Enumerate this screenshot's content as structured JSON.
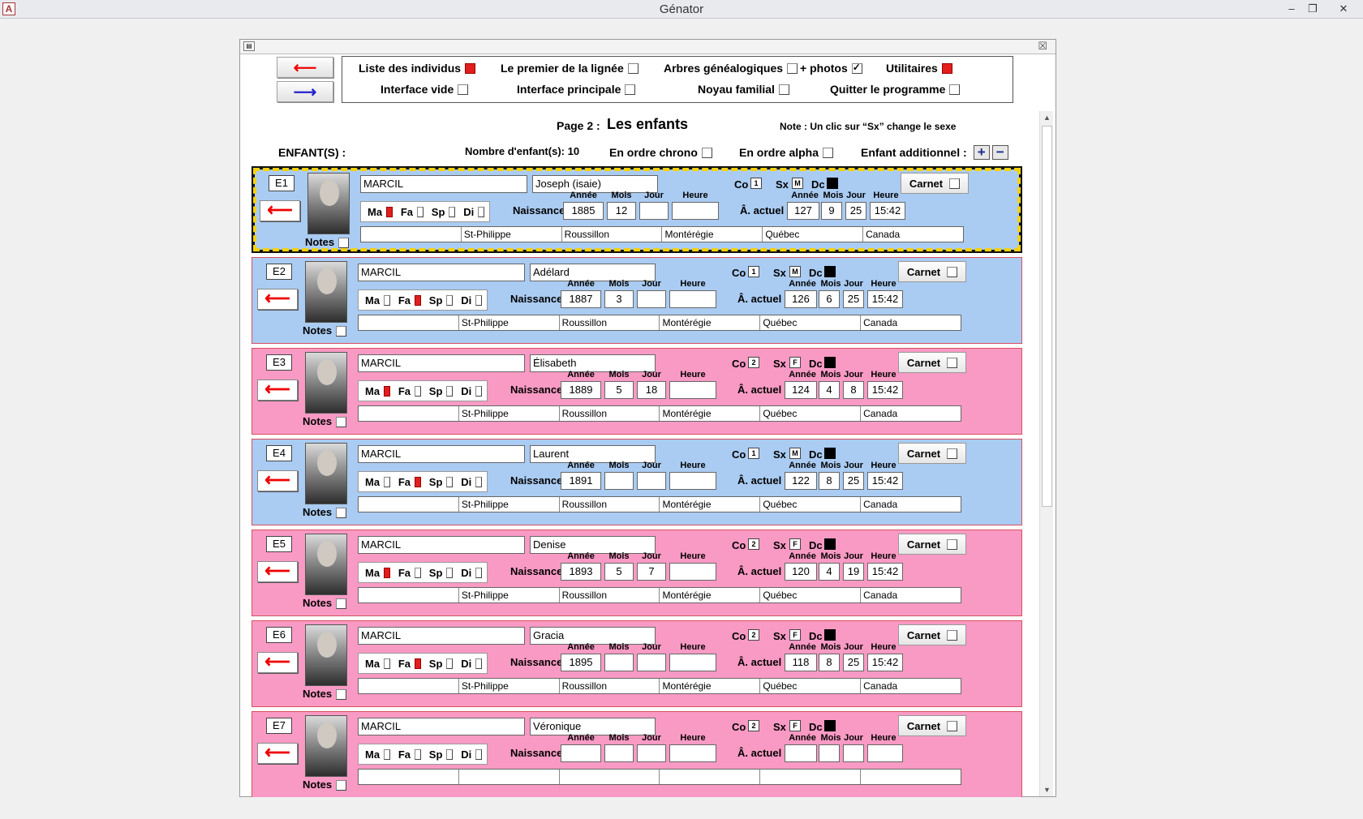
{
  "window": {
    "title": "Génator",
    "app_icon": "A",
    "min": "–",
    "max": "❐",
    "close": "✕"
  },
  "form": {
    "close": "☒"
  },
  "nav": {
    "back_glyph": "⟵",
    "forward_glyph": "⟶"
  },
  "menu": {
    "liste": "Liste des individus",
    "premier": "Le premier de la lignée",
    "arbres": "Arbres généalogiques",
    "photos": "+ photos",
    "utilitaires": "Utilitaires",
    "vide": "Interface vide",
    "principale": "Interface principale",
    "noyau": "Noyau familial",
    "quitter": "Quitter le programme"
  },
  "page": {
    "label": "Page 2 :",
    "title": "Les enfants",
    "note": "Note : Un clic sur “Sx” change le sexe",
    "enfants_label": "ENFANT(S) :",
    "nb_enfants": "Nombre d'enfant(s): 10",
    "chrono": "En ordre chrono",
    "alpha": "En ordre alpha",
    "additionnel": "Enfant additionnel :",
    "plus": "+",
    "minus": "−"
  },
  "labels": {
    "notes": "Notes",
    "ma": "Ma",
    "fa": "Fa",
    "sp": "Sp",
    "di": "Di",
    "naissance": "Naissance:",
    "actuel": "Â. actuel :",
    "annee": "Année",
    "mois": "Mois",
    "jour": "Jour",
    "heure": "Heure",
    "co": "Co",
    "sx": "Sx",
    "dc": "Dc",
    "carnet": "Carnet"
  },
  "children": [
    {
      "id": "E1",
      "nom": "MARCIL",
      "prenom": "Joseph (isaie)",
      "sexe": "M",
      "co": "1",
      "status": "ma",
      "annee": "1885",
      "mois": "12",
      "jour": "",
      "heure": "",
      "age_annee": "127",
      "age_mois": "9",
      "age_jour": "25",
      "age_heure": "15:42",
      "lieu": [
        "",
        "St-Philippe",
        "Roussillon",
        "Montérégie",
        "Québec",
        "Canada"
      ]
    },
    {
      "id": "E2",
      "nom": "MARCIL",
      "prenom": "Adélard",
      "sexe": "M",
      "co": "1",
      "status": "fa",
      "annee": "1887",
      "mois": "3",
      "jour": "",
      "heure": "",
      "age_annee": "126",
      "age_mois": "6",
      "age_jour": "25",
      "age_heure": "15:42",
      "lieu": [
        "",
        "St-Philippe",
        "Roussillon",
        "Montérégie",
        "Québec",
        "Canada"
      ]
    },
    {
      "id": "E3",
      "nom": "MARCIL",
      "prenom": "Élisabeth",
      "sexe": "F",
      "co": "2",
      "status": "ma",
      "annee": "1889",
      "mois": "5",
      "jour": "18",
      "heure": "",
      "age_annee": "124",
      "age_mois": "4",
      "age_jour": "8",
      "age_heure": "15:42",
      "lieu": [
        "",
        "St-Philippe",
        "Roussillon",
        "Montérégie",
        "Québec",
        "Canada"
      ]
    },
    {
      "id": "E4",
      "nom": "MARCIL",
      "prenom": "Laurent",
      "sexe": "M",
      "co": "1",
      "status": "fa",
      "annee": "1891",
      "mois": "",
      "jour": "",
      "heure": "",
      "age_annee": "122",
      "age_mois": "8",
      "age_jour": "25",
      "age_heure": "15:42",
      "lieu": [
        "",
        "St-Philippe",
        "Roussillon",
        "Montérégie",
        "Québec",
        "Canada"
      ]
    },
    {
      "id": "E5",
      "nom": "MARCIL",
      "prenom": "Denise",
      "sexe": "F",
      "co": "2",
      "status": "ma",
      "annee": "1893",
      "mois": "5",
      "jour": "7",
      "heure": "",
      "age_annee": "120",
      "age_mois": "4",
      "age_jour": "19",
      "age_heure": "15:42",
      "lieu": [
        "",
        "St-Philippe",
        "Roussillon",
        "Montérégie",
        "Québec",
        "Canada"
      ]
    },
    {
      "id": "E6",
      "nom": "MARCIL",
      "prenom": "Gracia",
      "sexe": "F",
      "co": "2",
      "status": "fa",
      "annee": "1895",
      "mois": "",
      "jour": "",
      "heure": "",
      "age_annee": "118",
      "age_mois": "8",
      "age_jour": "25",
      "age_heure": "15:42",
      "lieu": [
        "",
        "St-Philippe",
        "Roussillon",
        "Montérégie",
        "Québec",
        "Canada"
      ]
    },
    {
      "id": "E7",
      "nom": "MARCIL",
      "prenom": "Véronique",
      "sexe": "F",
      "co": "2",
      "status": "",
      "annee": "",
      "mois": "",
      "jour": "",
      "heure": "",
      "age_annee": "",
      "age_mois": "",
      "age_jour": "",
      "age_heure": "",
      "lieu": [
        "",
        "",
        "",
        "",
        "",
        ""
      ]
    }
  ],
  "colors": {
    "male": "#aacbf2",
    "female": "#f99ac4",
    "checked": "#e21d1d",
    "selected_border": "#f5d20b"
  }
}
